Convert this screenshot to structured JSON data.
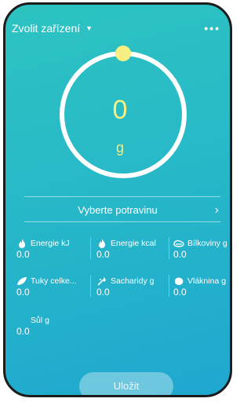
{
  "header": {
    "device_select_label": "Zvolit zařízení",
    "more_icon": "more-dots-icon"
  },
  "scale": {
    "value": "0",
    "unit": "g",
    "progress": 0
  },
  "food": {
    "select_label": "Vyberte potravinu"
  },
  "nutrients": {
    "energy_kj": {
      "label": "Energie kJ",
      "value": "0.0",
      "icon": "flame-icon"
    },
    "energy_kcal": {
      "label": "Energie kcal",
      "value": "0.0",
      "icon": "flame-icon"
    },
    "protein": {
      "label": "Bílkoviny g",
      "value": "0.0",
      "icon": "protein-icon"
    },
    "fat": {
      "label": "Tuky celke...",
      "value": "0.0",
      "icon": "leaf-icon"
    },
    "carbs": {
      "label": "Sacharidy g",
      "value": "0.0",
      "icon": "carbs-icon"
    },
    "fiber": {
      "label": "Vláknina g",
      "value": "0.0",
      "icon": "fiber-icon"
    },
    "salt": {
      "label": "Sůl g",
      "value": "0.0",
      "icon": ""
    }
  },
  "actions": {
    "save_label": "Uložit"
  },
  "colors": {
    "background_top": "#2dc3c0",
    "background_bottom": "#1fa7cf",
    "accent_yellow": "#f7ef82"
  }
}
